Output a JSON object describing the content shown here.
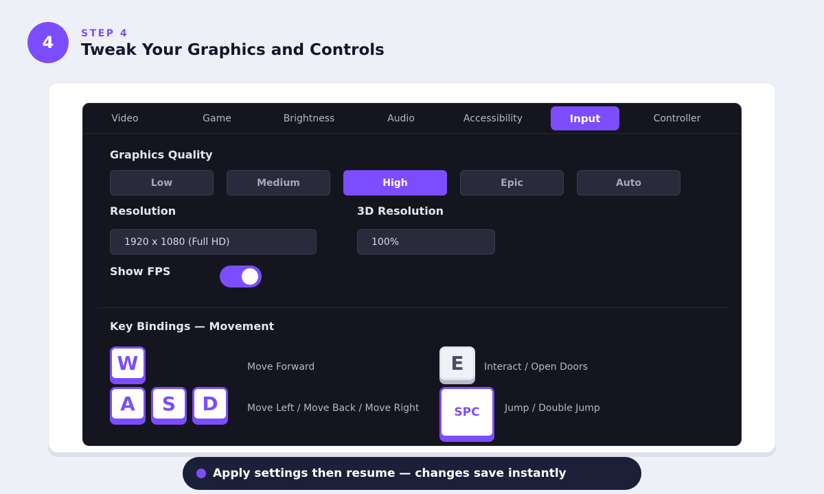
{
  "header": {
    "step_number": "4",
    "step_label": "STEP 4",
    "title": "Tweak Your Graphics and Controls"
  },
  "tabs": [
    {
      "label": "Video",
      "active": false
    },
    {
      "label": "Game",
      "active": false
    },
    {
      "label": "Brightness",
      "active": false
    },
    {
      "label": "Audio",
      "active": false
    },
    {
      "label": "Accessibility",
      "active": false
    },
    {
      "label": "Input",
      "active": true
    },
    {
      "label": "Controller",
      "active": false
    }
  ],
  "graphics_quality": {
    "label": "Graphics Quality",
    "options": [
      "Low",
      "Medium",
      "High",
      "Epic",
      "Auto"
    ],
    "selected": "High"
  },
  "resolution": {
    "label": "Resolution",
    "value": "1920 x 1080 (Full HD)"
  },
  "resolution_3d": {
    "label": "3D Resolution",
    "value": "100%"
  },
  "show_fps": {
    "label": "Show FPS",
    "enabled": true
  },
  "key_bindings": {
    "title": "Key Bindings — Movement",
    "keys": {
      "w": "W",
      "a": "A",
      "s": "S",
      "d": "D",
      "e": "E",
      "space": "SPC"
    },
    "actions": {
      "forward": "Move Forward",
      "lateral": "Move Left / Move Back / Move Right",
      "interact": "Interact / Open Doors",
      "jump": "Jump / Double Jump"
    }
  },
  "footer": {
    "message": "Apply settings then resume — changes save instantly"
  },
  "colors": {
    "accent": "#7c4dff",
    "panel_bg": "#15151f",
    "page_bg": "#eef0f7"
  }
}
